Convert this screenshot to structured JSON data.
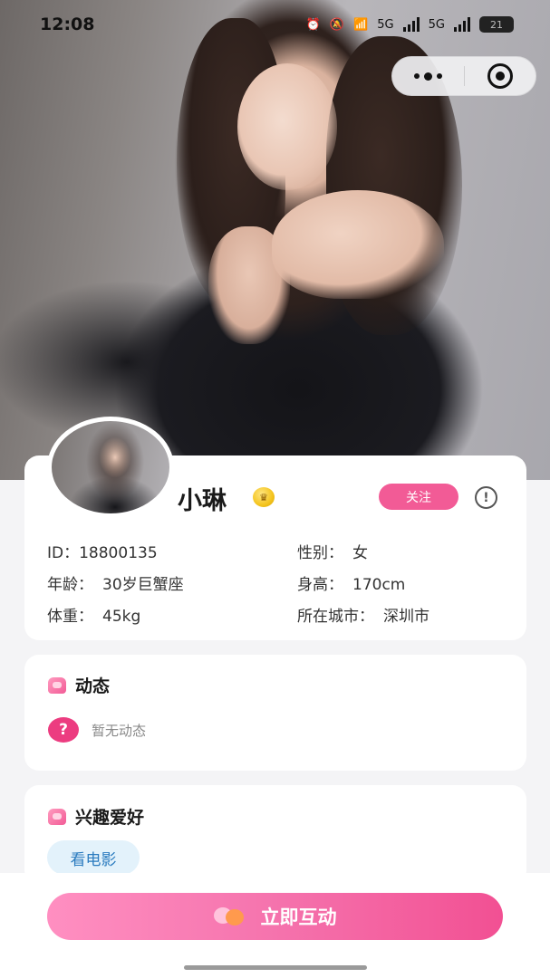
{
  "status_bar": {
    "time": "12:08",
    "network_1": "5G",
    "network_2": "5G",
    "battery": "21"
  },
  "capsule": {
    "more_icon": "more-dots-icon",
    "close_icon": "target-close-icon"
  },
  "profile": {
    "name": "小琳",
    "follow_label": "关注",
    "report_glyph": "!",
    "id_label": "ID：",
    "id_value": "18800135",
    "gender_label": "性别：",
    "gender_value": "女",
    "age_label": "年龄：",
    "age_value": "30岁巨蟹座",
    "height_label": "身高：",
    "height_value": "170cm",
    "weight_label": "体重：",
    "weight_value": "45kg",
    "city_label": "所在城市：",
    "city_value": "深圳市"
  },
  "moments": {
    "title": "动态",
    "empty_glyph": "?",
    "empty_text": "暂无动态"
  },
  "hobbies": {
    "title": "兴趣爱好",
    "tags": [
      "看电影"
    ]
  },
  "cta": {
    "label": "立即互动"
  },
  "colors": {
    "accent_pink": "#f25b96",
    "question_pink": "#ec3c80",
    "tag_bg": "#e3f2fb",
    "tag_text": "#2a7bbf"
  }
}
